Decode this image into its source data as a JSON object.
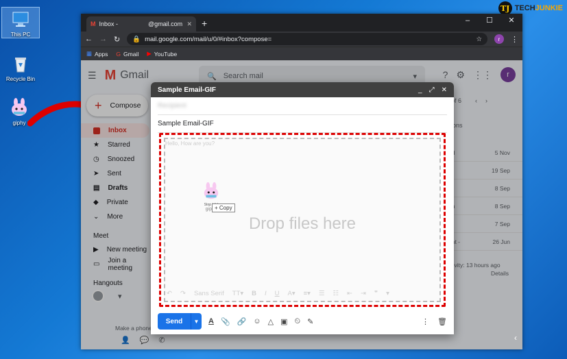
{
  "desktop": {
    "icons": [
      {
        "label": "This PC",
        "icon": "computer-icon"
      },
      {
        "label": "Recycle Bin",
        "icon": "recycle-bin-icon"
      },
      {
        "label": "giphy",
        "icon": "giphy-file-icon"
      }
    ],
    "brand": {
      "prefix": "TECH",
      "suffix": "JUNKIE",
      "logo": "TJ"
    }
  },
  "browser": {
    "tab_title": "Inbox - ",
    "tab_email": "@gmail.com",
    "url": "mail.google.com/mail/u/0/#inbox?compose=",
    "profile_initial": "r",
    "bookmarks": [
      "Apps",
      "Gmail",
      "YouTube"
    ]
  },
  "gmail": {
    "logo_text": "Gmail",
    "search_placeholder": "Search mail",
    "profile_initial": "r",
    "compose_label": "Compose",
    "nav": [
      {
        "label": "Inbox",
        "icon": "inbox-icon",
        "active": true
      },
      {
        "label": "Starred",
        "icon": "star-icon"
      },
      {
        "label": "Snoozed",
        "icon": "clock-icon"
      },
      {
        "label": "Sent",
        "icon": "send-icon"
      },
      {
        "label": "Drafts",
        "icon": "draft-icon",
        "bold": true
      },
      {
        "label": "Private",
        "icon": "label-icon"
      },
      {
        "label": "More",
        "icon": "chevron-down-icon"
      }
    ],
    "meet_title": "Meet",
    "meet_items": [
      "New meeting",
      "Join a meeting"
    ],
    "hangouts_title": "Hangouts",
    "hangouts_footer": "Make a phone",
    "pagination": "of 6",
    "tabs_partial": "ons",
    "mail_dates": [
      {
        "snippet": "ad",
        "date": "5 Nov"
      },
      {
        "snippet": "ts",
        "date": "19 Sep"
      },
      {
        "snippet": "te",
        "date": "8 Sep"
      },
      {
        "snippet": "en",
        "date": "8 Sep"
      },
      {
        "snippet": "tu",
        "date": "7 Sep"
      },
      {
        "snippet": "ant -",
        "date": "26 Jun"
      }
    ],
    "activity": "ctivity: 13 hours ago",
    "details": "Details"
  },
  "compose": {
    "window_title": "Sample Email-GIF",
    "to_value": "Recipient",
    "subject": "Sample Email-GIF",
    "body_placeholder": "Hello, How are you?",
    "drop_text": "Drop files here",
    "drag_file_label": "giphy",
    "drag_file_caption": "Stop (dir)",
    "copy_tip": "+ Copy",
    "font_name": "Sans Serif",
    "send_label": "Send"
  },
  "colors": {
    "accent": "#1a73e8",
    "inbox_red": "#d93025",
    "drop_border": "#dd0000"
  }
}
